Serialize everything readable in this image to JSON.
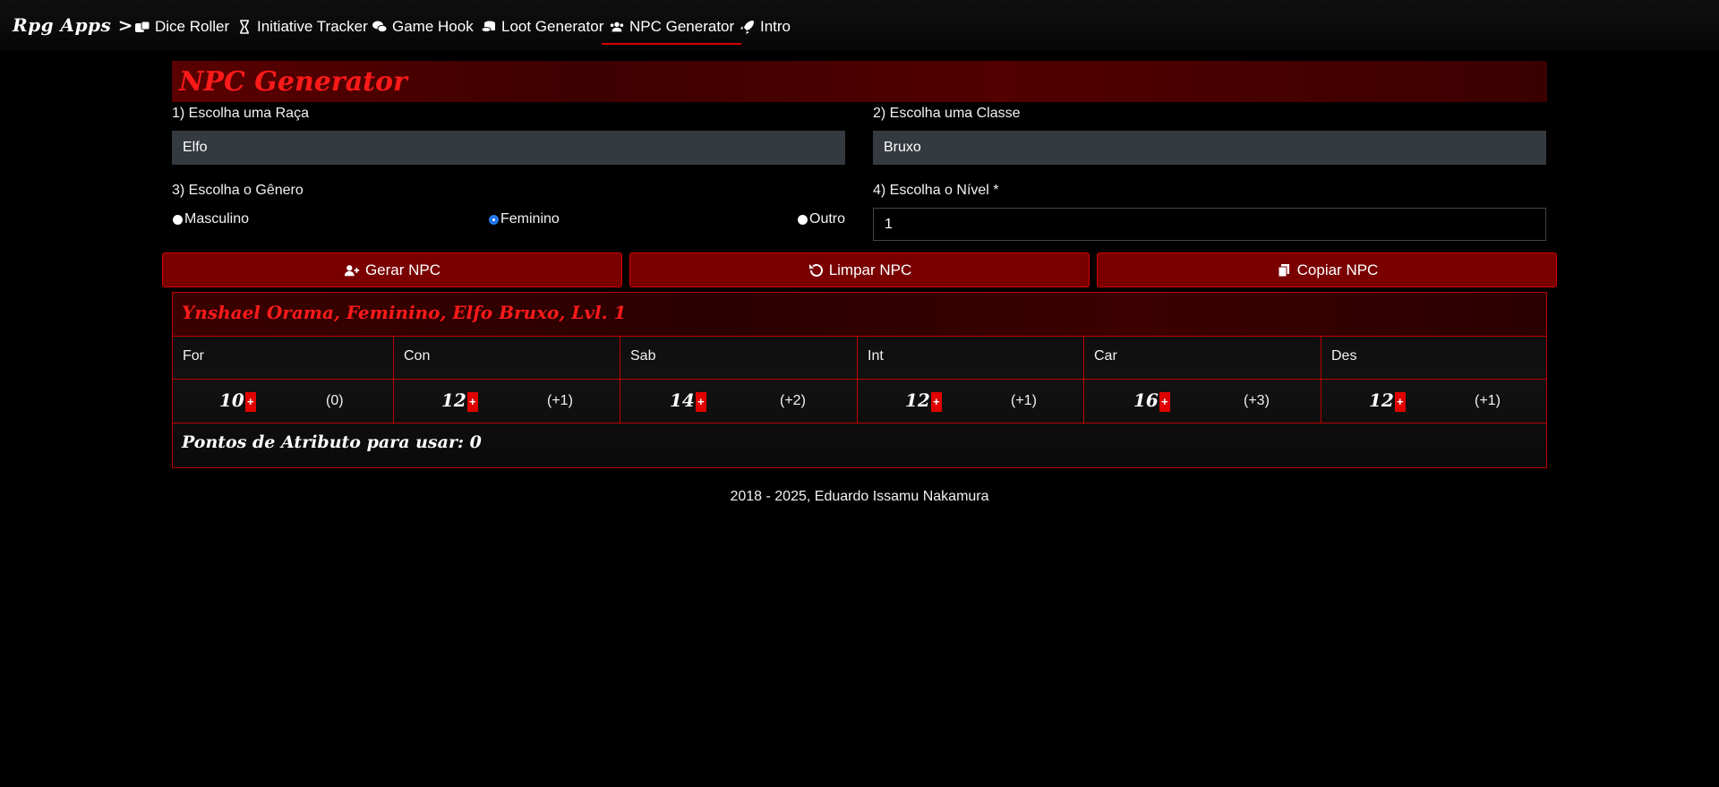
{
  "nav": {
    "brand": "Rpg Apps >",
    "items": [
      {
        "label": "Dice Roller",
        "icon": "dice-icon"
      },
      {
        "label": "Initiative Tracker",
        "icon": "hourglass-icon"
      },
      {
        "label": "Game Hook",
        "icon": "comments-icon"
      },
      {
        "label": "Loot Generator",
        "icon": "coins-icon"
      },
      {
        "label": "NPC Generator",
        "icon": "users-icon",
        "active": true
      },
      {
        "label": "Intro",
        "icon": "rocket-icon"
      }
    ]
  },
  "page_title": "NPC Generator",
  "form": {
    "race_label": "1) Escolha uma Raça",
    "race_value": "Elfo",
    "class_label": "2) Escolha uma Classe",
    "class_value": "Bruxo",
    "gender_label": "3) Escolha o Gênero",
    "gender_options": [
      {
        "label": "Masculino",
        "selected": false
      },
      {
        "label": "Feminino",
        "selected": true
      },
      {
        "label": "Outro",
        "selected": false
      }
    ],
    "level_label": "4) Escolha o Nível *",
    "level_value": "1"
  },
  "buttons": {
    "generate": "Gerar NPC",
    "clear": "Limpar NPC",
    "copy": "Copiar NPC"
  },
  "npc": {
    "header": "Ynshael Orama, Feminino, Elfo Bruxo, Lvl. 1",
    "attributes": [
      {
        "name": "For",
        "value": "10",
        "mod": "(0)"
      },
      {
        "name": "Con",
        "value": "12",
        "mod": "(+1)"
      },
      {
        "name": "Sab",
        "value": "14",
        "mod": "(+2)"
      },
      {
        "name": "Int",
        "value": "12",
        "mod": "(+1)"
      },
      {
        "name": "Car",
        "value": "16",
        "mod": "(+3)"
      },
      {
        "name": "Des",
        "value": "12",
        "mod": "(+1)"
      }
    ],
    "plus_label": "+",
    "points_text": "Pontos de Atributo para usar: 0"
  },
  "footer": "2018 - 2025, Eduardo Issamu Nakamura",
  "colors": {
    "accent": "#c00000",
    "button_bg": "#7a0000",
    "title_red": "#ff1a1a"
  }
}
